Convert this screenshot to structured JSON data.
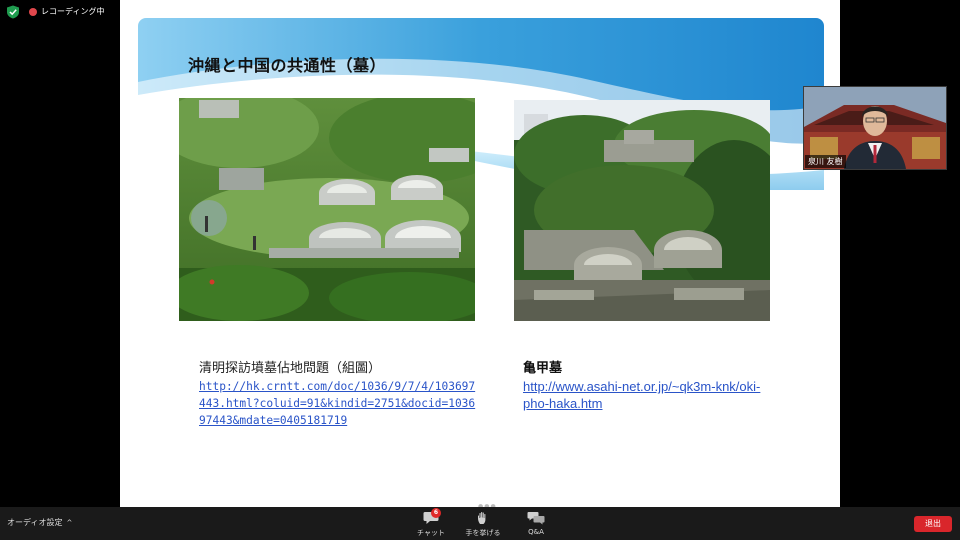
{
  "status": {
    "recording_label": "レコーディング中"
  },
  "slide": {
    "title": "沖縄と中国の共通性（墓）",
    "left_caption": {
      "title": "清明探訪墳墓佔地問題（組圖）",
      "link_lines": [
        "http://hk.crntt.com/doc/1036/9/7/4/103697",
        "443.html?coluid=91&kindid=2751&docid=1036",
        "97443&mdate=0405181719"
      ]
    },
    "right_caption": {
      "title": "亀甲墓",
      "link_lines": [
        "http://www.asahi-net.or.jp/~qk3m-knk/oki-",
        "pho-haka.htm"
      ]
    }
  },
  "video": {
    "participant_name": "泉川 友樹"
  },
  "toolbar": {
    "audio_settings_label": "オーディオ設定",
    "audio_caret": "^",
    "chat_label": "チャット",
    "chat_badge": "6",
    "raise_hand_label": "手を挙げる",
    "qa_label": "Q&A",
    "leave_label": "退出"
  },
  "colors": {
    "slide_wave": "#3aa0dc",
    "link": "#2a54c8",
    "leave_button": "#d9262b",
    "badge": "#e02828",
    "shield": "#1f9c4f"
  }
}
